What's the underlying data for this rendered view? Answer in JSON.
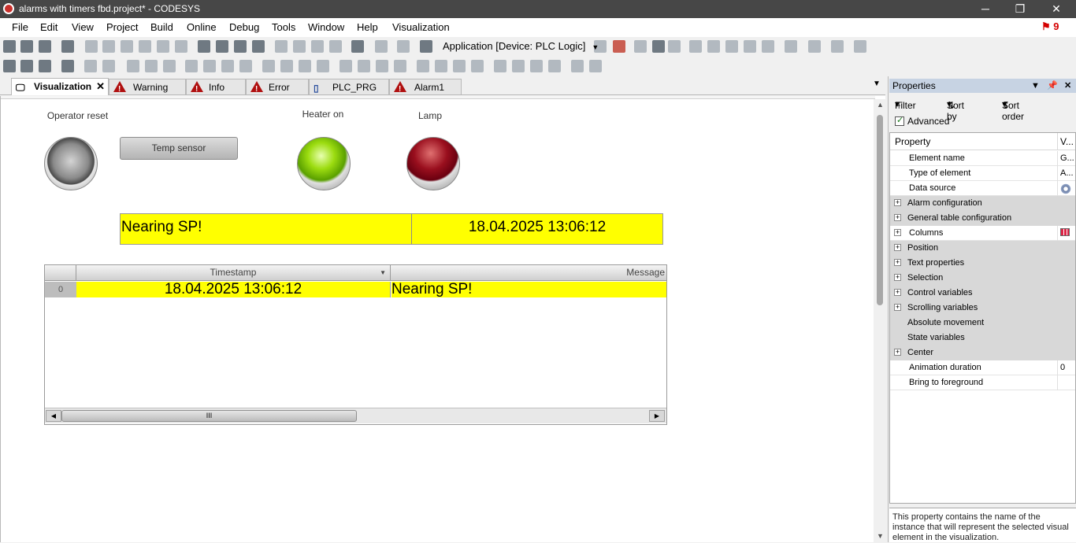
{
  "window": {
    "title": "alarms with timers fbd.project* - CODESYS",
    "minimize": "─",
    "maximize": "❐",
    "close": "✕"
  },
  "menu": {
    "items": [
      "File",
      "Edit",
      "View",
      "Project",
      "Build",
      "Online",
      "Debug",
      "Tools",
      "Window",
      "Help",
      "Visualization"
    ],
    "notification_count": "9"
  },
  "toolbar": {
    "application_selector": "Application [Device: PLC Logic]"
  },
  "tabs": [
    {
      "label": "Visualization",
      "icon": "visualization-icon",
      "active": true
    },
    {
      "label": "Warning",
      "icon": "alarm-warning-icon",
      "active": false
    },
    {
      "label": "Info",
      "icon": "alarm-warning-icon",
      "active": false
    },
    {
      "label": "Error",
      "icon": "alarm-warning-icon",
      "active": false
    },
    {
      "label": "PLC_PRG",
      "icon": "program-icon",
      "active": false
    },
    {
      "label": "Alarm1",
      "icon": "alarm-warning-icon",
      "active": false
    }
  ],
  "visualization": {
    "operator_reset_label": "Operator reset",
    "temp_sensor_button": "Temp sensor",
    "heater_label": "Heater on",
    "lamp_label": "Lamp",
    "banner": {
      "message": "Nearing SP!",
      "timestamp": "18.04.2025 13:06:12",
      "color": "#ffff00"
    },
    "alarm_table": {
      "columns": [
        "Timestamp",
        "Message"
      ],
      "rows": [
        {
          "index": "0",
          "timestamp": "18.04.2025 13:06:12",
          "message": "Nearing SP!"
        }
      ],
      "scroll_thumb_grip": "III"
    }
  },
  "properties": {
    "title": "Properties",
    "filter": "Filter",
    "sort_by": "Sort by",
    "sort_order": "Sort order",
    "advanced": "Advanced",
    "header_property": "Property",
    "header_value": "V...",
    "rows": [
      {
        "name": "Element name",
        "value": "G...",
        "category": false,
        "expandable": false
      },
      {
        "name": "Type of element",
        "value": "A...",
        "category": false,
        "expandable": false
      },
      {
        "name": "Data source",
        "value": "",
        "icon": "gear-icon",
        "category": false,
        "expandable": false
      },
      {
        "name": "Alarm configuration",
        "value": "",
        "category": true,
        "expandable": true
      },
      {
        "name": "General table configuration",
        "value": "",
        "category": true,
        "expandable": true
      },
      {
        "name": "Columns",
        "value": "",
        "icon": "columns-icon",
        "category": false,
        "expandable": true
      },
      {
        "name": "Position",
        "value": "",
        "category": true,
        "expandable": true
      },
      {
        "name": "Text properties",
        "value": "",
        "category": true,
        "expandable": true
      },
      {
        "name": "Selection",
        "value": "",
        "category": true,
        "expandable": true
      },
      {
        "name": "Control variables",
        "value": "",
        "category": true,
        "expandable": true
      },
      {
        "name": "Scrolling variables",
        "value": "",
        "category": true,
        "expandable": true
      },
      {
        "name": "Absolute movement",
        "value": "",
        "category": true,
        "expandable": false
      },
      {
        "name": "State variables",
        "value": "",
        "category": true,
        "expandable": false
      },
      {
        "name": "Center",
        "value": "",
        "category": true,
        "expandable": true
      },
      {
        "name": "Animation duration",
        "value": "0",
        "category": false,
        "expandable": false
      },
      {
        "name": "Bring to foreground",
        "value": "",
        "category": false,
        "expandable": false
      }
    ],
    "description": "This property contains the name of the instance that will represent the selected visual element in the visualization."
  }
}
